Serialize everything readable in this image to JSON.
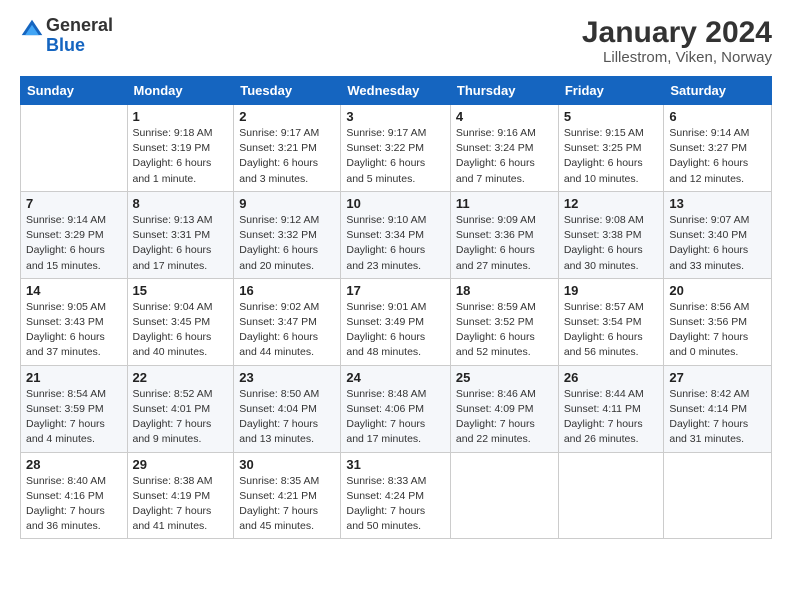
{
  "header": {
    "logo_general": "General",
    "logo_blue": "Blue",
    "title": "January 2024",
    "subtitle": "Lillestrom, Viken, Norway"
  },
  "calendar": {
    "days_of_week": [
      "Sunday",
      "Monday",
      "Tuesday",
      "Wednesday",
      "Thursday",
      "Friday",
      "Saturday"
    ],
    "weeks": [
      [
        {
          "day": "",
          "info": ""
        },
        {
          "day": "1",
          "info": "Sunrise: 9:18 AM\nSunset: 3:19 PM\nDaylight: 6 hours\nand 1 minute."
        },
        {
          "day": "2",
          "info": "Sunrise: 9:17 AM\nSunset: 3:21 PM\nDaylight: 6 hours\nand 3 minutes."
        },
        {
          "day": "3",
          "info": "Sunrise: 9:17 AM\nSunset: 3:22 PM\nDaylight: 6 hours\nand 5 minutes."
        },
        {
          "day": "4",
          "info": "Sunrise: 9:16 AM\nSunset: 3:24 PM\nDaylight: 6 hours\nand 7 minutes."
        },
        {
          "day": "5",
          "info": "Sunrise: 9:15 AM\nSunset: 3:25 PM\nDaylight: 6 hours\nand 10 minutes."
        },
        {
          "day": "6",
          "info": "Sunrise: 9:14 AM\nSunset: 3:27 PM\nDaylight: 6 hours\nand 12 minutes."
        }
      ],
      [
        {
          "day": "7",
          "info": "Sunrise: 9:14 AM\nSunset: 3:29 PM\nDaylight: 6 hours\nand 15 minutes."
        },
        {
          "day": "8",
          "info": "Sunrise: 9:13 AM\nSunset: 3:31 PM\nDaylight: 6 hours\nand 17 minutes."
        },
        {
          "day": "9",
          "info": "Sunrise: 9:12 AM\nSunset: 3:32 PM\nDaylight: 6 hours\nand 20 minutes."
        },
        {
          "day": "10",
          "info": "Sunrise: 9:10 AM\nSunset: 3:34 PM\nDaylight: 6 hours\nand 23 minutes."
        },
        {
          "day": "11",
          "info": "Sunrise: 9:09 AM\nSunset: 3:36 PM\nDaylight: 6 hours\nand 27 minutes."
        },
        {
          "day": "12",
          "info": "Sunrise: 9:08 AM\nSunset: 3:38 PM\nDaylight: 6 hours\nand 30 minutes."
        },
        {
          "day": "13",
          "info": "Sunrise: 9:07 AM\nSunset: 3:40 PM\nDaylight: 6 hours\nand 33 minutes."
        }
      ],
      [
        {
          "day": "14",
          "info": "Sunrise: 9:05 AM\nSunset: 3:43 PM\nDaylight: 6 hours\nand 37 minutes."
        },
        {
          "day": "15",
          "info": "Sunrise: 9:04 AM\nSunset: 3:45 PM\nDaylight: 6 hours\nand 40 minutes."
        },
        {
          "day": "16",
          "info": "Sunrise: 9:02 AM\nSunset: 3:47 PM\nDaylight: 6 hours\nand 44 minutes."
        },
        {
          "day": "17",
          "info": "Sunrise: 9:01 AM\nSunset: 3:49 PM\nDaylight: 6 hours\nand 48 minutes."
        },
        {
          "day": "18",
          "info": "Sunrise: 8:59 AM\nSunset: 3:52 PM\nDaylight: 6 hours\nand 52 minutes."
        },
        {
          "day": "19",
          "info": "Sunrise: 8:57 AM\nSunset: 3:54 PM\nDaylight: 6 hours\nand 56 minutes."
        },
        {
          "day": "20",
          "info": "Sunrise: 8:56 AM\nSunset: 3:56 PM\nDaylight: 7 hours\nand 0 minutes."
        }
      ],
      [
        {
          "day": "21",
          "info": "Sunrise: 8:54 AM\nSunset: 3:59 PM\nDaylight: 7 hours\nand 4 minutes."
        },
        {
          "day": "22",
          "info": "Sunrise: 8:52 AM\nSunset: 4:01 PM\nDaylight: 7 hours\nand 9 minutes."
        },
        {
          "day": "23",
          "info": "Sunrise: 8:50 AM\nSunset: 4:04 PM\nDaylight: 7 hours\nand 13 minutes."
        },
        {
          "day": "24",
          "info": "Sunrise: 8:48 AM\nSunset: 4:06 PM\nDaylight: 7 hours\nand 17 minutes."
        },
        {
          "day": "25",
          "info": "Sunrise: 8:46 AM\nSunset: 4:09 PM\nDaylight: 7 hours\nand 22 minutes."
        },
        {
          "day": "26",
          "info": "Sunrise: 8:44 AM\nSunset: 4:11 PM\nDaylight: 7 hours\nand 26 minutes."
        },
        {
          "day": "27",
          "info": "Sunrise: 8:42 AM\nSunset: 4:14 PM\nDaylight: 7 hours\nand 31 minutes."
        }
      ],
      [
        {
          "day": "28",
          "info": "Sunrise: 8:40 AM\nSunset: 4:16 PM\nDaylight: 7 hours\nand 36 minutes."
        },
        {
          "day": "29",
          "info": "Sunrise: 8:38 AM\nSunset: 4:19 PM\nDaylight: 7 hours\nand 41 minutes."
        },
        {
          "day": "30",
          "info": "Sunrise: 8:35 AM\nSunset: 4:21 PM\nDaylight: 7 hours\nand 45 minutes."
        },
        {
          "day": "31",
          "info": "Sunrise: 8:33 AM\nSunset: 4:24 PM\nDaylight: 7 hours\nand 50 minutes."
        },
        {
          "day": "",
          "info": ""
        },
        {
          "day": "",
          "info": ""
        },
        {
          "day": "",
          "info": ""
        }
      ]
    ]
  }
}
